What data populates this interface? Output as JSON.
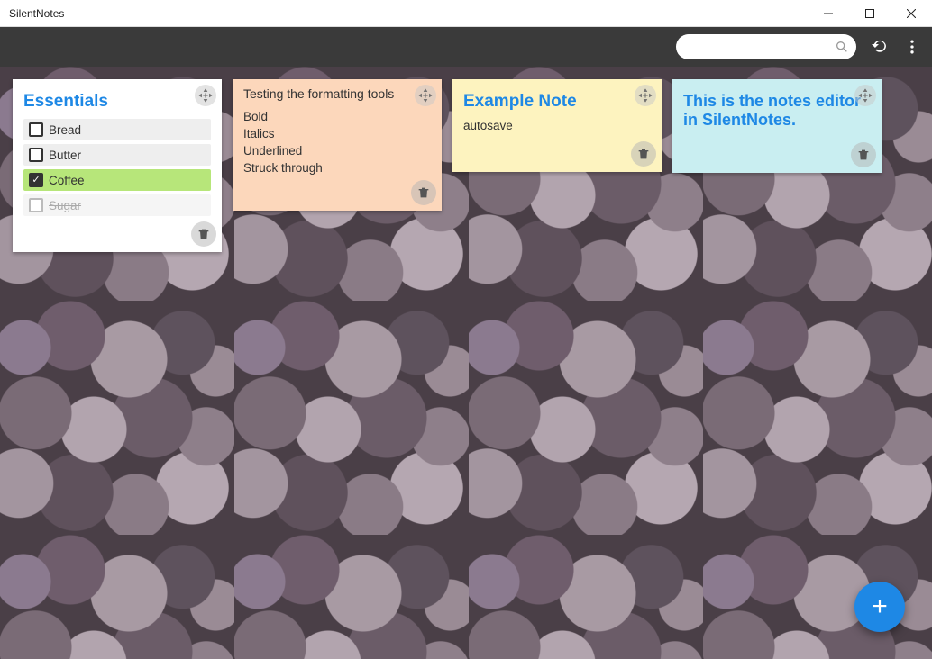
{
  "window": {
    "title": "SilentNotes"
  },
  "toolbar": {
    "search_placeholder": ""
  },
  "notes": [
    {
      "title": "Essentials",
      "type": "checklist",
      "color": "white",
      "items": [
        {
          "label": "Bread",
          "checked": false,
          "disabled": false
        },
        {
          "label": "Butter",
          "checked": false,
          "disabled": false
        },
        {
          "label": "Coffee",
          "checked": true,
          "disabled": false
        },
        {
          "label": "Sugar",
          "checked": false,
          "disabled": true
        }
      ]
    },
    {
      "text_title": "Testing the formatting tools",
      "type": "text",
      "color": "orange",
      "lines": [
        "Bold",
        "Italics",
        "Underlined",
        "Struck through"
      ]
    },
    {
      "title": "Example Note",
      "type": "text",
      "color": "yellow",
      "lines": [
        "autosave"
      ]
    },
    {
      "title": "This is the notes editor in SilentNotes.",
      "type": "text",
      "color": "cyan",
      "lines": []
    }
  ]
}
